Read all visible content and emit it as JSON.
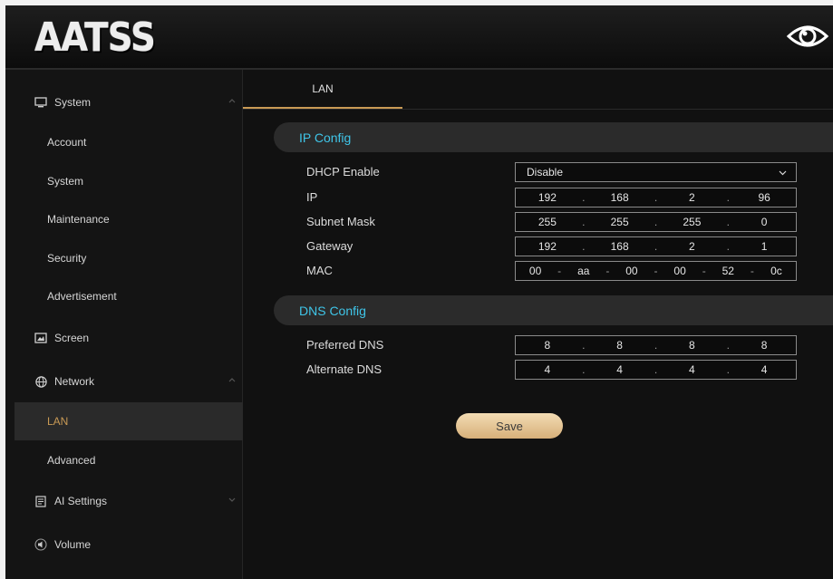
{
  "header": {
    "logo_text": "AATSS",
    "eye_icon": "eye-icon"
  },
  "sidebar": {
    "system": {
      "label": "System",
      "icon": "monitor-icon"
    },
    "system_items": [
      "Account",
      "System",
      "Maintenance",
      "Security",
      "Advertisement"
    ],
    "screen": {
      "label": "Screen",
      "icon": "screen-icon"
    },
    "network": {
      "label": "Network",
      "icon": "globe-icon"
    },
    "network_items": [
      "LAN",
      "Advanced"
    ],
    "ai_settings": {
      "label": "AI Settings",
      "icon": "document-icon"
    },
    "volume": {
      "label": "Volume",
      "icon": "speaker-icon"
    },
    "active_item": "LAN"
  },
  "tabs": [
    {
      "label": "LAN",
      "active": true
    }
  ],
  "ip_config": {
    "title": "IP Config",
    "dhcp": {
      "label": "DHCP Enable",
      "value": "Disable"
    },
    "ip": {
      "label": "IP",
      "octets": [
        "192",
        "168",
        "2",
        "96"
      ]
    },
    "subnet": {
      "label": "Subnet Mask",
      "octets": [
        "255",
        "255",
        "255",
        "0"
      ]
    },
    "gateway": {
      "label": "Gateway",
      "octets": [
        "192",
        "168",
        "2",
        "1"
      ]
    },
    "mac": {
      "label": "MAC",
      "parts": [
        "00",
        "aa",
        "00",
        "00",
        "52",
        "0c"
      ]
    }
  },
  "dns_config": {
    "title": "DNS Config",
    "preferred": {
      "label": "Preferred DNS",
      "octets": [
        "8",
        "8",
        "8",
        "8"
      ]
    },
    "alternate": {
      "label": "Alternate DNS",
      "octets": [
        "4",
        "4",
        "4",
        "4"
      ]
    }
  },
  "save_label": "Save",
  "colors": {
    "accent_gold": "#c99a55",
    "section_title": "#3fc5e8",
    "background": "#131313"
  }
}
